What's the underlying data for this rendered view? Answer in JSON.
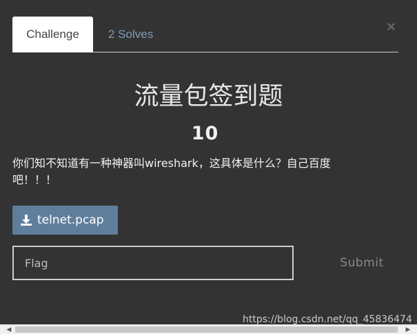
{
  "tabs": {
    "challenge_label": "Challenge",
    "solves_label": "2 Solves"
  },
  "close_glyph": "×",
  "challenge": {
    "title": "流量包签到题",
    "points": "10",
    "description": "你们知不知道有一种神器叫wireshark，这具体是什么？自己百度吧！！！"
  },
  "file": {
    "name": "telnet.pcap",
    "icon": "download-icon"
  },
  "flag": {
    "placeholder": "Flag",
    "value": ""
  },
  "submit_label": "Submit",
  "watermark": "https://blog.csdn.net/qq_45836474",
  "colors": {
    "background": "#333333",
    "active_tab": "#ffffff",
    "solves_tab_text": "#7e9bb8",
    "file_button": "#5f7e9c",
    "submit_text": "#8a8a8a"
  }
}
